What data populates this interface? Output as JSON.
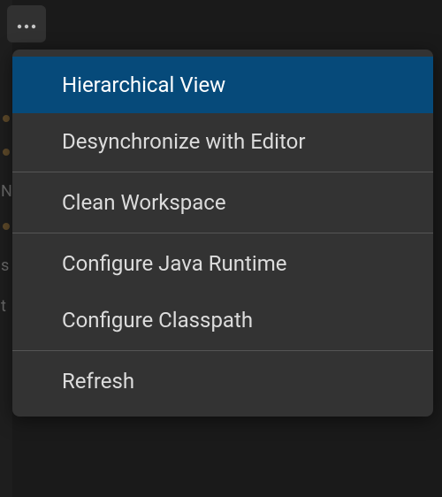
{
  "more_button": {
    "name": "more-button"
  },
  "menu": {
    "groups": [
      [
        {
          "label": "Hierarchical View",
          "selected": true,
          "name": "menu-item-hierarchical-view"
        },
        {
          "label": "Desynchronize with Editor",
          "selected": false,
          "name": "menu-item-desync-editor"
        }
      ],
      [
        {
          "label": "Clean Workspace",
          "selected": false,
          "name": "menu-item-clean-workspace"
        }
      ],
      [
        {
          "label": "Configure Java Runtime",
          "selected": false,
          "name": "menu-item-configure-java-runtime"
        },
        {
          "label": "Configure Classpath",
          "selected": false,
          "name": "menu-item-configure-classpath"
        }
      ],
      [
        {
          "label": "Refresh",
          "selected": false,
          "name": "menu-item-refresh"
        }
      ]
    ]
  }
}
